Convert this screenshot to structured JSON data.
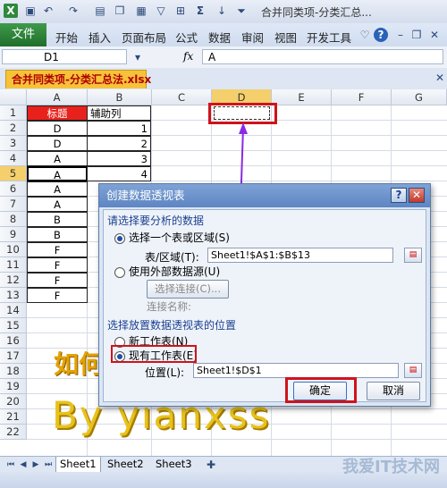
{
  "title_bar": {
    "title": "合并同类项-分类汇总..."
  },
  "ribbon": {
    "file_tab": "文件",
    "tabs": [
      "开始",
      "插入",
      "页面布局",
      "公式",
      "数据",
      "审阅",
      "视图",
      "开发工具"
    ]
  },
  "formula_bar": {
    "name_box": "D1",
    "fx": "fx",
    "content": "A"
  },
  "document_tab": "合并同类项-分类汇总法.xlsx",
  "grid": {
    "columns": [
      "A",
      "B",
      "C",
      "D",
      "E",
      "F",
      "G"
    ],
    "rows": [
      "1",
      "2",
      "3",
      "4",
      "5",
      "6",
      "7",
      "8",
      "9",
      "10",
      "11",
      "12",
      "13",
      "14",
      "15",
      "16",
      "17",
      "18",
      "19",
      "20",
      "21",
      "22"
    ],
    "cells_A": [
      "标题",
      "D",
      "D",
      "A",
      "A",
      "A",
      "A",
      "B",
      "B",
      "F",
      "F",
      "F",
      "F"
    ],
    "cells_B": [
      "辅助列",
      "1",
      "2",
      "3",
      "4",
      "",
      "",
      "",
      "",
      "",
      "",
      "",
      ""
    ]
  },
  "wordart": {
    "line1": "如何",
    "line2": "By yianxss"
  },
  "dialog": {
    "title": "创建数据透视表",
    "help": "?",
    "close": "✕",
    "section1_label": "请选择要分析的数据",
    "opt_select_table": "选择一个表或区域(S)",
    "table_range_label": "表/区域(T):",
    "table_range_value": "Sheet1!$A$1:$B$13",
    "opt_external": "使用外部数据源(U)",
    "choose_connection": "选择连接(C)...",
    "connection_name": "连接名称:",
    "section2_label": "选择放置数据透视表的位置",
    "opt_new_sheet": "新工作表(N)",
    "opt_existing_sheet": "现有工作表(E)",
    "location_label": "位置(L):",
    "location_value": "Sheet1!$D$1",
    "ok": "确定",
    "cancel": "取消"
  },
  "sheets": [
    "Sheet1",
    "Sheet2",
    "Sheet3"
  ],
  "watermark": "我爱IT技术网",
  "colors": {
    "header_red": "#e8211c",
    "highlight_red": "#d0121b",
    "arrow_purple": "#8a2be2",
    "file_tab_green": "#2d8a3a"
  }
}
